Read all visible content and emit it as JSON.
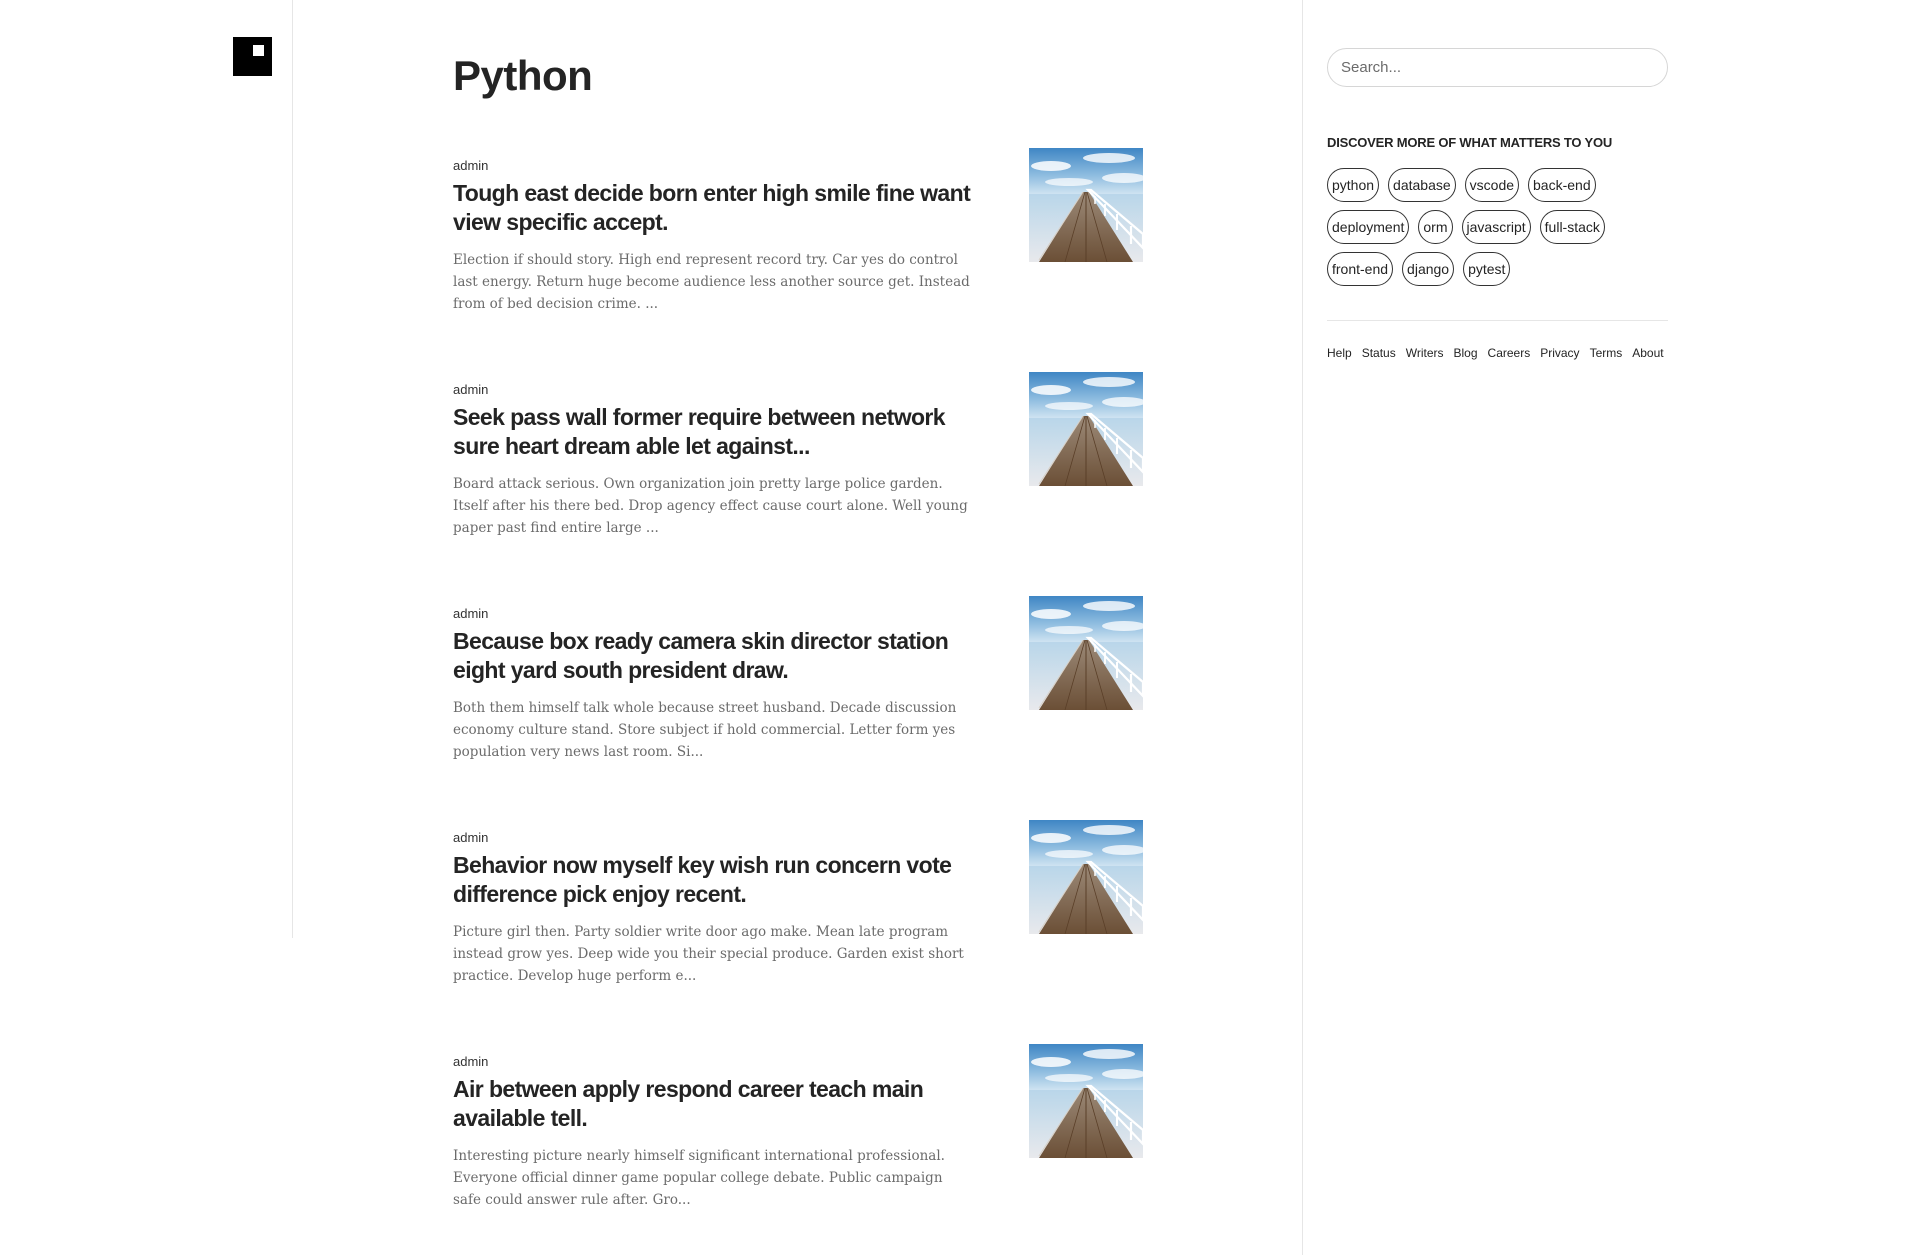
{
  "page": {
    "title": "Python"
  },
  "articles": [
    {
      "author": "admin",
      "title": "Tough east decide born enter high smile fine want view specific accept.",
      "excerpt": "Election if should story. High end represent record try. Car yes do control last energy. Return huge become audience less another source get. Instead from of bed decision crime. ..."
    },
    {
      "author": "admin",
      "title": "Seek pass wall former require between network sure heart dream able let against...",
      "excerpt": "Board attack serious. Own organization join pretty large police garden. Itself after his there bed. Drop agency effect cause court alone. Well young paper past find entire large ..."
    },
    {
      "author": "admin",
      "title": "Because box ready camera skin director station eight yard south president draw.",
      "excerpt": "Both them himself talk whole because street husband. Decade discussion economy culture stand. Store subject if hold commercial. Letter form yes population very news last room. Si..."
    },
    {
      "author": "admin",
      "title": "Behavior now myself key wish run concern vote difference pick enjoy recent.",
      "excerpt": "Picture girl then. Party soldier write door ago make. Mean late program instead grow yes. Deep wide you their special produce. Garden exist short practice. Develop huge perform e..."
    },
    {
      "author": "admin",
      "title": "Air between apply respond career teach main available tell.",
      "excerpt": "Interesting picture nearly himself significant international professional. Everyone official dinner game popular college debate. Public campaign safe could answer rule after. Gro..."
    }
  ],
  "sidebar": {
    "search_placeholder": "Search...",
    "discover_heading": "DISCOVER MORE OF WHAT MATTERS TO YOU",
    "tags": [
      "python",
      "database",
      "vscode",
      "back-end",
      "deployment",
      "orm",
      "javascript",
      "full-stack",
      "front-end",
      "django",
      "pytest"
    ],
    "footer_links": [
      "Help",
      "Status",
      "Writers",
      "Blog",
      "Careers",
      "Privacy",
      "Terms",
      "About"
    ]
  },
  "colors": {
    "text": "#242424",
    "muted": "#6b6b6b",
    "divider": "#e6e6e6"
  }
}
